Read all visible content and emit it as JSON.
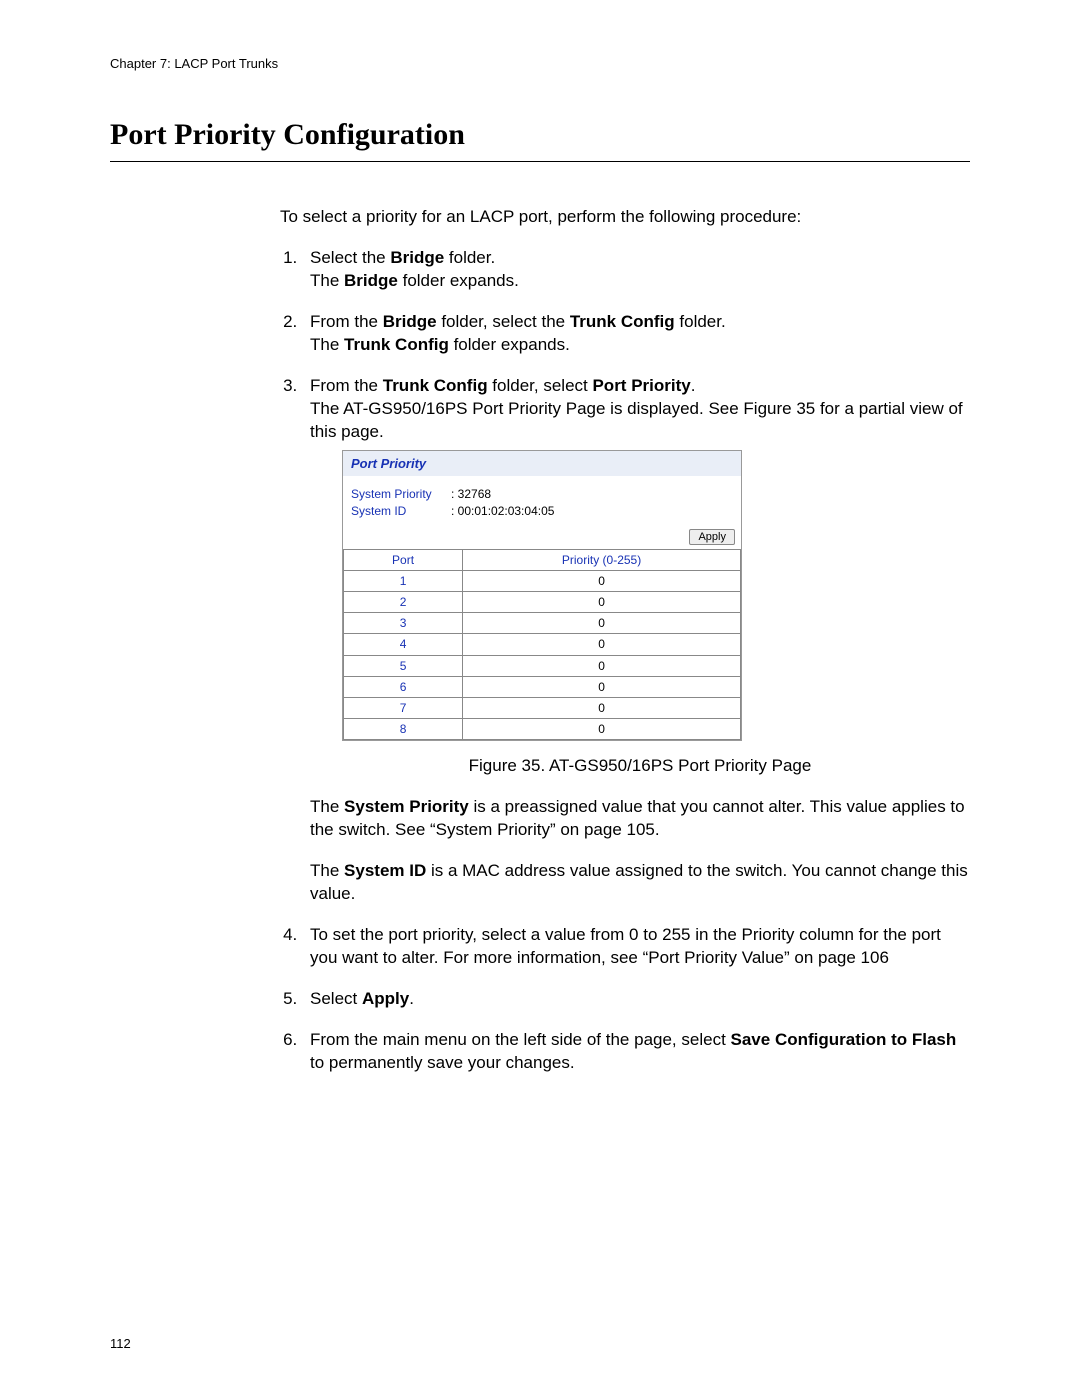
{
  "header": {
    "chapter": "Chapter 7: LACP Port Trunks"
  },
  "title": "Port Priority Configuration",
  "intro": "To select a priority for an LACP port, perform the following procedure:",
  "steps": {
    "s1_a": "Select the ",
    "s1_bold1": "Bridge",
    "s1_b": " folder.",
    "s1_line2_a": "The ",
    "s1_line2_bold": "Bridge",
    "s1_line2_b": " folder expands.",
    "s2_a": "From the ",
    "s2_bold1": "Bridge",
    "s2_b": " folder, select the ",
    "s2_bold2": "Trunk Config",
    "s2_c": " folder.",
    "s2_line2_a": "The ",
    "s2_line2_bold": "Trunk Config",
    "s2_line2_b": " folder expands.",
    "s3_a": "From the ",
    "s3_bold1": "Trunk Config",
    "s3_b": " folder, select ",
    "s3_bold2": "Port Priority",
    "s3_c": ".",
    "s3_line2": "The AT-GS950/16PS Port Priority Page is displayed. See Figure 35 for a partial view of this page.",
    "s3_after1_a": "The ",
    "s3_after1_bold": "System Priority",
    "s3_after1_b": " is a preassigned value that you cannot alter. This value applies to the switch. See “System Priority” on page 105.",
    "s3_after2_a": "The ",
    "s3_after2_bold": "System ID",
    "s3_after2_b": " is a MAC address value assigned to the switch. You cannot change this value.",
    "s4": "To set the port priority, select a value from 0 to 255 in the Priority column for the port you want to alter. For more information, see “Port Priority Value” on page 106",
    "s5_a": "Select ",
    "s5_bold": "Apply",
    "s5_b": ".",
    "s6_a": "From the main menu on the left side of the page, select ",
    "s6_bold": "Save Configuration to Flash",
    "s6_b": " to permanently save your changes."
  },
  "figure": {
    "title": "Port Priority",
    "sys_priority_label": "System Priority",
    "sys_priority_value": ": 32768",
    "sys_id_label": "System ID",
    "sys_id_value": ": 00:01:02:03:04:05",
    "apply": "Apply",
    "col_port": "Port",
    "col_prio": "Priority (0-255)",
    "rows": [
      {
        "port": "1",
        "prio": "0"
      },
      {
        "port": "2",
        "prio": "0"
      },
      {
        "port": "3",
        "prio": "0"
      },
      {
        "port": "4",
        "prio": "0"
      },
      {
        "port": "5",
        "prio": "0"
      },
      {
        "port": "6",
        "prio": "0"
      },
      {
        "port": "7",
        "prio": "0"
      },
      {
        "port": "8",
        "prio": "0"
      }
    ],
    "caption": "Figure 35. AT-GS950/16PS Port Priority Page"
  },
  "page_number": "112"
}
